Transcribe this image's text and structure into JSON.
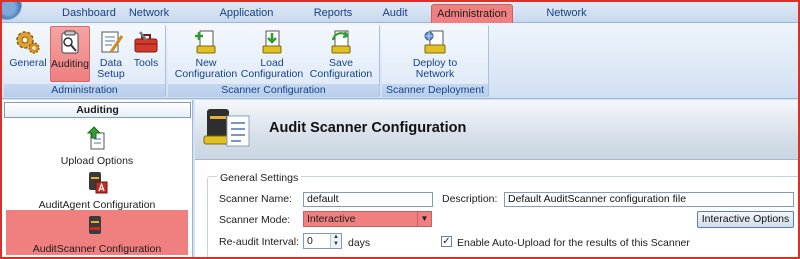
{
  "tabs": [
    {
      "label": "Dashboard"
    },
    {
      "label": "Network View"
    },
    {
      "label": "Application Licensing"
    },
    {
      "label": "Reports"
    },
    {
      "label": "Audit Trail"
    },
    {
      "label": "Administration",
      "active": true
    },
    {
      "label": "Network Discovery"
    }
  ],
  "ribbon": {
    "administration": {
      "label": "Administration",
      "buttons": [
        {
          "label": "General",
          "icon": "gears-icon"
        },
        {
          "label": "Auditing",
          "icon": "auditing-icon",
          "active": true
        },
        {
          "label": "Data\nSetup",
          "icon": "data-setup-icon"
        },
        {
          "label": "Tools",
          "icon": "toolbox-icon"
        }
      ]
    },
    "scanner_configuration": {
      "label": "Scanner Configuration",
      "buttons": [
        {
          "label": "New\nConfiguration",
          "icon": "new-config-icon"
        },
        {
          "label": "Load\nConfiguration",
          "icon": "load-config-icon"
        },
        {
          "label": "Save\nConfiguration",
          "icon": "save-config-icon"
        }
      ]
    },
    "scanner_deployment": {
      "label": "Scanner Deployment",
      "buttons": [
        {
          "label": "Deploy to\nNetwork",
          "icon": "deploy-icon"
        }
      ]
    }
  },
  "left_panel": {
    "header": "Auditing",
    "items": [
      {
        "label": "Upload Options",
        "icon": "upload-icon"
      },
      {
        "label": "AuditAgent Configuration",
        "icon": "audit-agent-icon"
      },
      {
        "label": "AuditScanner Configuration",
        "icon": "audit-scanner-icon",
        "active": true
      }
    ]
  },
  "main": {
    "title": "Audit Scanner Configuration",
    "general_settings": "General Settings",
    "scanner_name_label": "Scanner Name:",
    "scanner_name_value": "default",
    "description_label": "Description:",
    "description_value": "Default AuditScanner configuration file",
    "scanner_mode_label": "Scanner Mode:",
    "scanner_mode_value": "Interactive",
    "interactive_options_label": "Interactive Options",
    "reaudit_label": "Re-audit Interval:",
    "reaudit_value": "0",
    "reaudit_unit": "days",
    "autoupload_label": "Enable Auto-Upload for the results of this Scanner",
    "autoupload_checked": true
  },
  "colors": {
    "highlight": "#f08080",
    "ribbon_text": "#15428b",
    "frame_border": "#d9302a"
  }
}
